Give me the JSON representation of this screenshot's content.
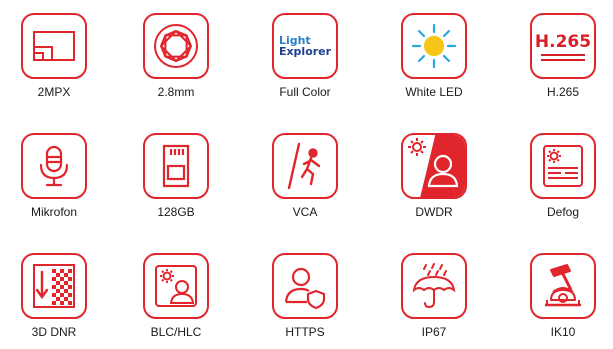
{
  "features": [
    {
      "label": "2MPX",
      "icon": "resolution-icon"
    },
    {
      "label": "2.8mm",
      "icon": "lens-aperture-icon"
    },
    {
      "label": "Full Color",
      "icon": "light-explorer-logo",
      "logo_text": [
        "Light",
        "Explorer"
      ]
    },
    {
      "label": "White LED",
      "icon": "sun-icon"
    },
    {
      "label": "H.265",
      "icon": "h265-codec-icon",
      "icon_text": "H.265"
    },
    {
      "label": "Mikrofon",
      "icon": "microphone-icon"
    },
    {
      "label": "128GB",
      "icon": "sd-card-icon"
    },
    {
      "label": "VCA",
      "icon": "intrusion-person-icon"
    },
    {
      "label": "DWDR",
      "icon": "wide-dynamic-range-icon"
    },
    {
      "label": "Defog",
      "icon": "defog-icon"
    },
    {
      "label": "3D DNR",
      "icon": "noise-reduction-icon"
    },
    {
      "label": "BLC/HLC",
      "icon": "backlight-compensation-icon"
    },
    {
      "label": "HTTPS",
      "icon": "secure-user-icon"
    },
    {
      "label": "IP67",
      "icon": "umbrella-rain-icon"
    },
    {
      "label": "IK10",
      "icon": "vandal-proof-hammer-icon"
    }
  ],
  "colors": {
    "accent": "#e0262c",
    "text": "#1a1a1a",
    "logo_blue": "#2b7fc4",
    "logo_navy": "#1f3f8f"
  }
}
